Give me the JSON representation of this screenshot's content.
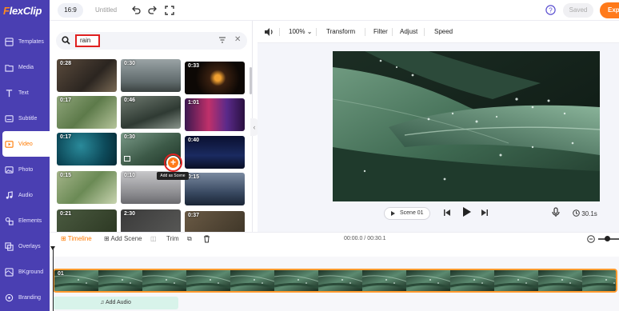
{
  "app": {
    "logo_prefix": "F",
    "logo_rest": "lexClip"
  },
  "topbar": {
    "ratio": "16:9",
    "title": "Untitled",
    "saved": "Saved",
    "export": "Exp"
  },
  "sidebar": {
    "items": [
      {
        "label": "Templates",
        "icon": "templates-icon"
      },
      {
        "label": "Media",
        "icon": "media-icon"
      },
      {
        "label": "Text",
        "icon": "text-icon"
      },
      {
        "label": "Subtitle",
        "icon": "subtitle-icon"
      },
      {
        "label": "Video",
        "icon": "video-icon",
        "active": true
      },
      {
        "label": "Photo",
        "icon": "photo-icon"
      },
      {
        "label": "Audio",
        "icon": "audio-icon"
      },
      {
        "label": "Elements",
        "icon": "elements-icon"
      },
      {
        "label": "Overlays",
        "icon": "overlays-icon"
      },
      {
        "label": "BKground",
        "icon": "background-icon"
      },
      {
        "label": "Branding",
        "icon": "branding-icon"
      }
    ]
  },
  "search": {
    "value": "rain"
  },
  "results": {
    "durations": [
      "0:28",
      "0:30",
      "0:33",
      "0:17",
      "0:46",
      "1:01",
      "0:17",
      "0:30",
      "0:40",
      "0:15",
      "0:10",
      "0:15",
      "0:21",
      "2:30",
      "0:37"
    ],
    "add_tooltip": "Add as Scene"
  },
  "editbar": {
    "zoom": "100%",
    "transform": "Transform",
    "filter": "Filter",
    "adjust": "Adjust",
    "speed": "Speed"
  },
  "player": {
    "scene": "Scene 01",
    "duration": "30.1s"
  },
  "timeline": {
    "tab": "Timeline",
    "add_scene": "Add Scene",
    "trim": "Trim",
    "time": "00:00.0 / 00:30.1",
    "clip_label": "01",
    "add_audio": "Add Audio"
  },
  "colors": {
    "sidebar": "#4a3fb2",
    "accent": "#ff7a1a",
    "highlight": "#e02020"
  }
}
